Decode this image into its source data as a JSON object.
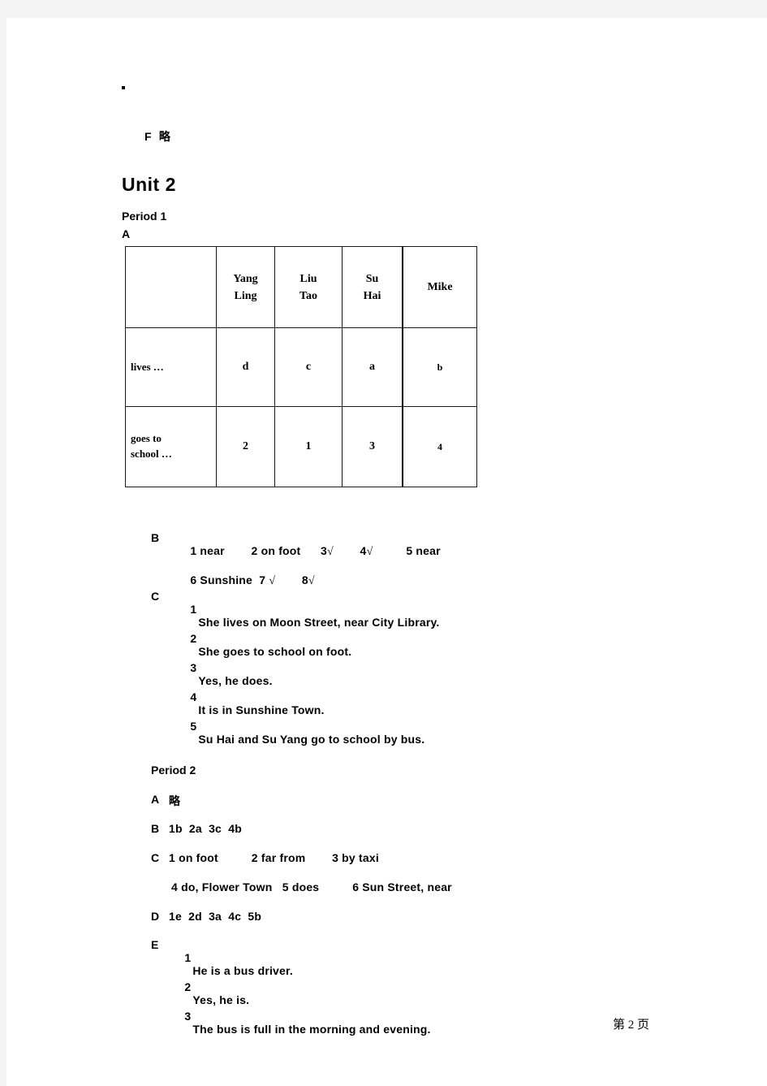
{
  "page": {
    "stray_mark": "·",
    "prev_section_tail": "F  略",
    "footer": "第 2 页"
  },
  "unit": {
    "title": "Unit 2",
    "periods": [
      {
        "label": "Period 1",
        "sections": [
          {
            "label": "A"
          }
        ]
      },
      {
        "label": "Period 2"
      }
    ]
  },
  "table": {
    "name": "period1-section-a-table",
    "corner": "",
    "columns": [
      {
        "line1": "Yang",
        "line2": "Ling"
      },
      {
        "line1": "Liu",
        "line2": "Tao"
      },
      {
        "line1": "Su",
        "line2": "Hai"
      },
      {
        "line1": "Mike",
        "line2": ""
      }
    ],
    "rows": [
      {
        "header_line1": "lives  …",
        "header_line2": "",
        "cells": [
          "d",
          "c",
          "a",
          "b"
        ]
      },
      {
        "header_line1": "goes  to",
        "header_line2": "school  …",
        "cells": [
          "2",
          "1",
          "3",
          "4"
        ]
      }
    ]
  },
  "period1": {
    "section_b": {
      "label": "B",
      "line1": "1 near        2 on foot      3",
      "line1_tick1": "√",
      "line1_mid": "        4",
      "line1_tick2": "√",
      "line1_end": "          5 near",
      "line2": "6 Sunshine  7 ",
      "line2_tick1": "√",
      "line2_mid": "        8",
      "line2_tick2": "√"
    },
    "section_c": {
      "label": "C",
      "items": [
        {
          "num": "1",
          "text": "She lives on Moon Street, near City Library."
        },
        {
          "num": "2",
          "text": "She goes to school on foot."
        },
        {
          "num": "3",
          "text": "Yes, he does."
        },
        {
          "num": "4",
          "text": "It is in Sunshine Town."
        },
        {
          "num": "5",
          "text": "Su Hai and Su Yang go to school by bus."
        }
      ]
    }
  },
  "period2": {
    "section_a": {
      "label": "A",
      "text": "略"
    },
    "section_b": {
      "label": "B",
      "text": "1b  2a  3c  4b"
    },
    "section_c": {
      "label": "C",
      "line1": "1 on foot          2 far from        3 by taxi",
      "line2": "4 do, Flower Town   5 does          6 Sun Street, near"
    },
    "section_d": {
      "label": "D",
      "text": "1e  2d  3a  4c  5b"
    },
    "section_e": {
      "label": "E",
      "items": [
        {
          "num": "1",
          "text": "He is a bus driver."
        },
        {
          "num": "2",
          "text": "Yes, he is."
        },
        {
          "num": "3",
          "text": "The bus is full in the morning and evening."
        }
      ]
    }
  }
}
